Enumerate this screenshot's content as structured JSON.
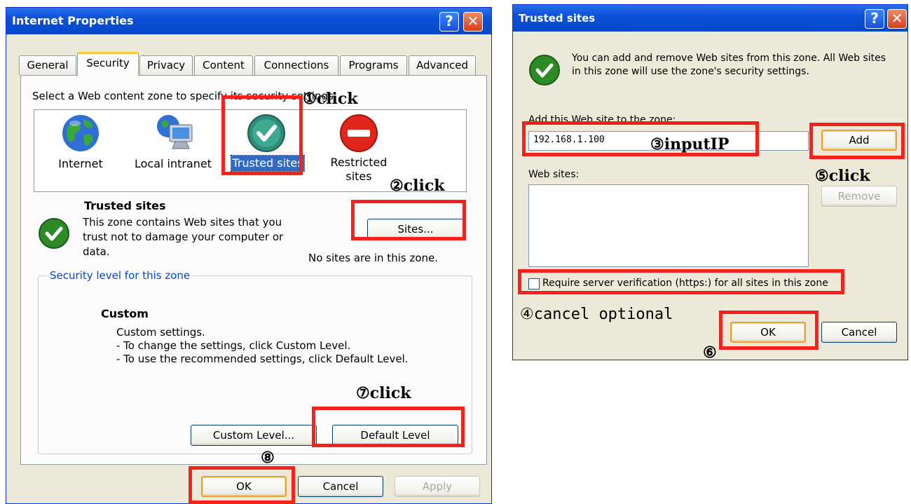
{
  "internet_properties": {
    "title": "Internet Properties",
    "help_glyph": "?",
    "close_glyph": "✕",
    "tabs": [
      "General",
      "Security",
      "Privacy",
      "Content",
      "Connections",
      "Programs",
      "Advanced"
    ],
    "active_tab": "Security",
    "zone_prompt": "Select a Web content zone to specify its security settings.",
    "zones": [
      {
        "label": "Internet",
        "icon": "globe-icon"
      },
      {
        "label": "Local intranet",
        "icon": "computer-globe-icon"
      },
      {
        "label": "Trusted sites",
        "icon": "checkmark-icon",
        "selected": true
      },
      {
        "label_line1": "Restricted",
        "label_line2": "sites",
        "icon": "no-entry-icon"
      }
    ],
    "zone_info_title": "Trusted sites",
    "zone_info_line1": "This zone contains Web sites that you",
    "zone_info_line2": "trust not to damage your computer or",
    "zone_info_line3": "data.",
    "sites_button": "Sites...",
    "no_sites_text": "No sites are in this zone.",
    "security_group_title": "Security level for this zone",
    "level_name": "Custom",
    "level_line1": "Custom settings.",
    "level_line2": "- To change the settings, click Custom Level.",
    "level_line3": "- To use the recommended settings, click Default Level.",
    "custom_level_button": "Custom Level...",
    "default_level_button": "Default Level",
    "ok_button": "OK",
    "cancel_button": "Cancel",
    "apply_button": "Apply"
  },
  "trusted_sites": {
    "title": "Trusted sites",
    "help_glyph": "?",
    "close_glyph": "✕",
    "info_line1": "You can add and remove Web sites from this zone. All Web sites",
    "info_line2": "in this zone will use the zone's security settings.",
    "add_label": "Add this Web site to the zone:",
    "add_value": "192.168.1.100",
    "add_button": "Add",
    "websites_label": "Web sites:",
    "remove_button": "Remove",
    "https_checkbox_label": "Require server verification (https:) for all sites in this zone",
    "https_checked": false,
    "ok_button": "OK",
    "cancel_button": "Cancel"
  },
  "annotations": {
    "a1": "①click",
    "a2": "②click",
    "a3": "③inputIP",
    "a4": "④cancel optional",
    "a5": "⑤click",
    "a6": "⑥",
    "a7": "⑦click",
    "a8": "⑧"
  },
  "colors": {
    "highlight": "#f5221b",
    "title_bar": "#0a50d8",
    "window_bg": "#ece9d8",
    "group_title": "#0046d5",
    "selection": "#316ac5"
  }
}
